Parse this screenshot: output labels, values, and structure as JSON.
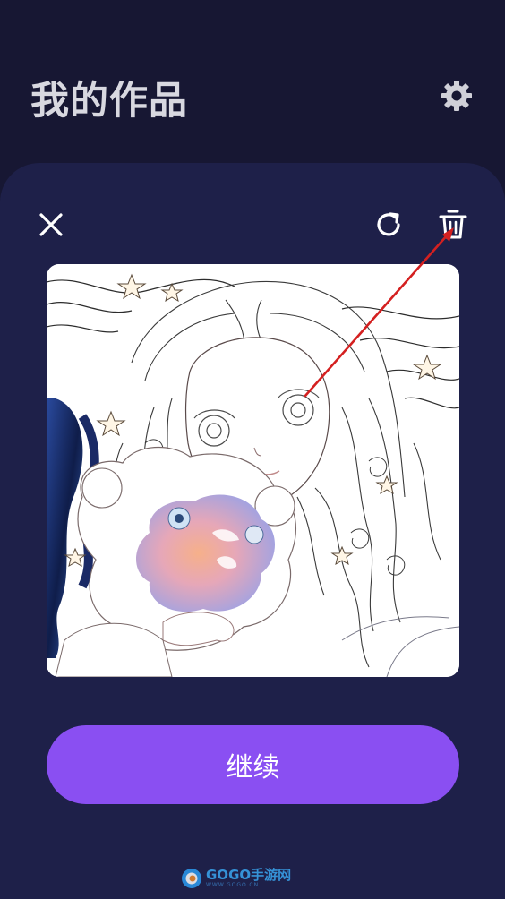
{
  "header": {
    "title": "我的作品",
    "settings_icon": "gear-icon"
  },
  "card": {
    "close_icon": "close-icon",
    "redo_icon": "redo-icon",
    "delete_icon": "trash-icon",
    "artwork_subject": "coloring-page-girl-with-teddy-bear"
  },
  "actions": {
    "continue_label": "继续"
  },
  "watermark": {
    "brand": "GOGO手游网",
    "site": "WWW.GOGO.CN"
  },
  "colors": {
    "background": "#171733",
    "card": "#1e2049",
    "accent": "#8a4ff2",
    "annotation_arrow": "#d42020"
  }
}
